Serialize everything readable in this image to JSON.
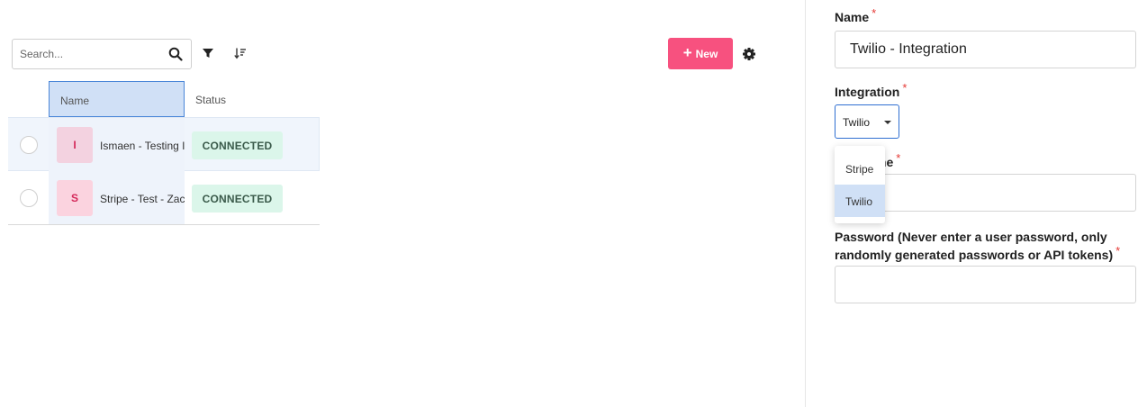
{
  "toolbar": {
    "search_placeholder": "Search...",
    "search_icon": "search-icon",
    "filter_icon": "filter-icon",
    "sort_icon": "sort-icon",
    "new_button": {
      "icon": "+",
      "label": "New"
    },
    "settings_icon": "gear-icon"
  },
  "table": {
    "columns": [
      "Name",
      "Status"
    ],
    "rows": [
      {
        "initial": "I",
        "name": "Ismaen - Testing I",
        "status": "CONNECTED",
        "avatar_color": "#f3d2e0"
      },
      {
        "initial": "S",
        "name": "Stripe - Test - Zac",
        "status": "CONNECTED",
        "avatar_color": "#fbd3df"
      }
    ]
  },
  "form": {
    "name": {
      "label": "Name",
      "required_mark": "*",
      "value": "Twilio - Integration"
    },
    "integration": {
      "label": "Integration",
      "required_mark": "*",
      "selected": "Twilio",
      "options": [
        "Stripe",
        "Twilio"
      ]
    },
    "username": {
      "label_visible": "me",
      "required_mark": "*",
      "value": ""
    },
    "password": {
      "label_line1": "Password (Never enter a user password, only",
      "label_line2": "randomly generated passwords or API tokens)",
      "required_mark": "*",
      "value": ""
    }
  },
  "colors": {
    "accent": "#f7517f",
    "selection": "#d0e0f6",
    "focus_border": "#2f6fd1",
    "status_connected_bg": "#dbf6ea",
    "required": "#e53935"
  }
}
